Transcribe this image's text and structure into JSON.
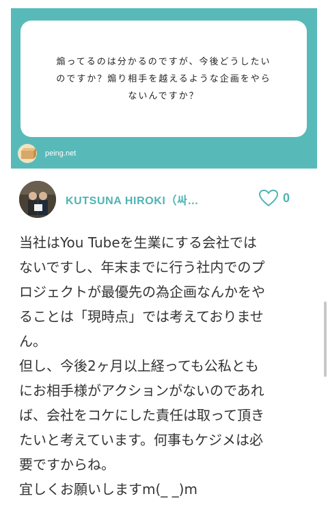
{
  "question": {
    "text": "煽ってるのは分かるのですが、今後どうしたい\nのですか？煽り相手を越えるような企画をやら\nないんですか？",
    "source": "peing.net"
  },
  "answer": {
    "author": "KUTSUNA HIROKI（싸…",
    "like_count": "0",
    "body": "当社はYou Tubeを生業にする会社では\nないですし、年末までに行う社内でのプ\nロジェクトが最優先の為企画なんかをや\nることは「現時点」では考えておりませ\nん。\n但し、今後2ヶ月以上経っても公私とも\nにお相手様がアクションがないのであれ\nば、会社をコケにした責任は取って頂き\nたいと考えています。何事もケジメは必\n要ですからね。\n宜しくお願いしますm(_ _)m"
  },
  "colors": {
    "accent": "#4fb3b3",
    "panel": "#58b9b9"
  },
  "icons": {
    "brand": "peing-box-logo-icon",
    "like": "heart-outline-icon",
    "avatar": "user-avatar"
  }
}
